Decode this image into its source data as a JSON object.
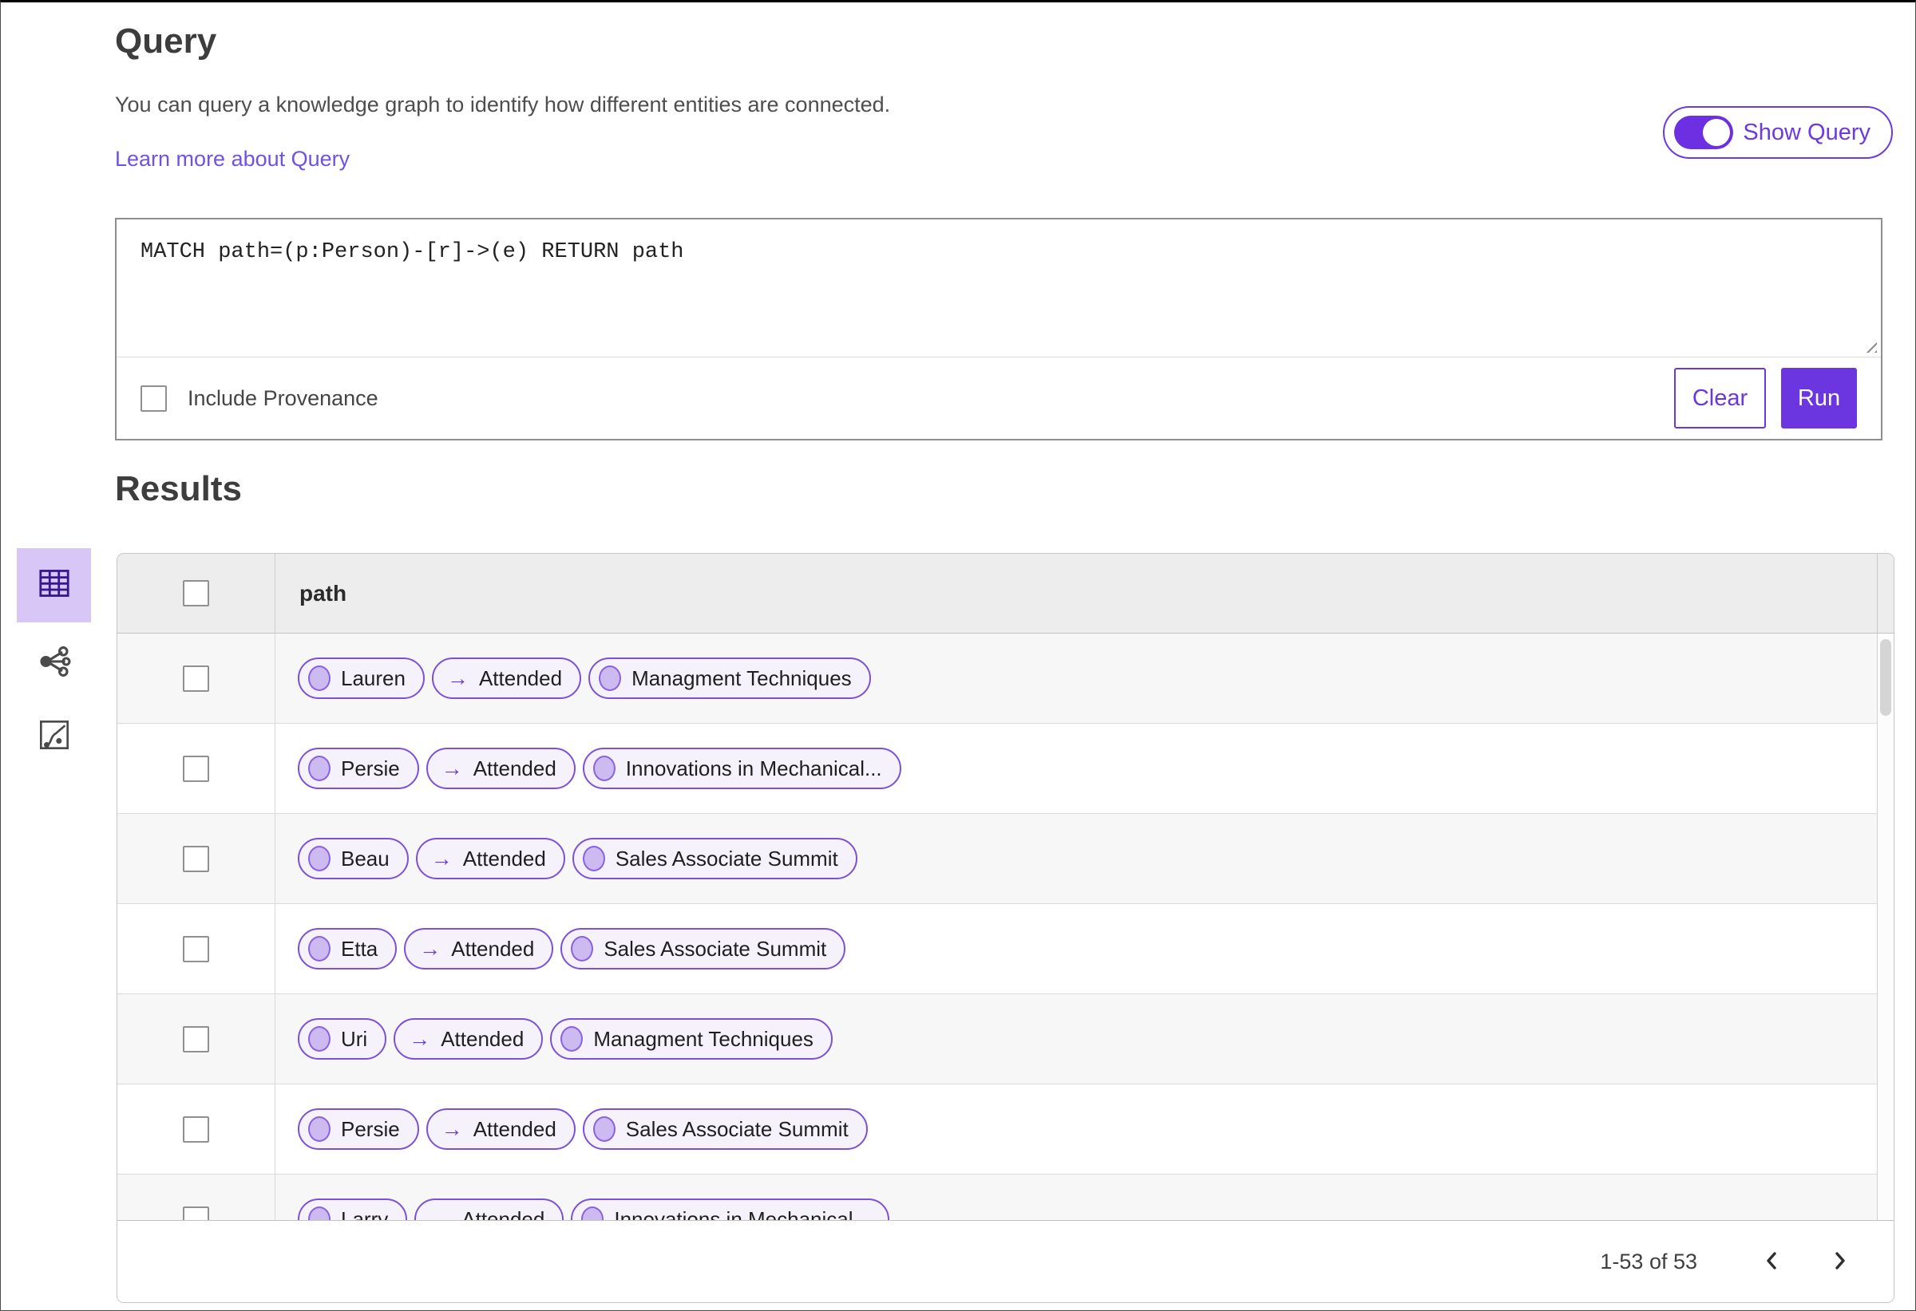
{
  "colors": {
    "accent_purple": "#6b35df",
    "pill_border": "#7b51d9",
    "pill_background": "#f5f2fc",
    "selected_view_background": "#d8c6f7"
  },
  "query": {
    "title": "Query",
    "description": "You can query a knowledge graph to identify how different entities are connected.",
    "learn_more_link": "Learn more about Query",
    "show_query_toggle_label": "Show Query",
    "show_query_toggle_on": true,
    "editor_text": "MATCH path=(p:Person)-[r]->(e) RETURN path",
    "include_provenance_label": "Include Provenance",
    "include_provenance_checked": false,
    "clear_button": "Clear",
    "run_button": "Run"
  },
  "results": {
    "title": "Results",
    "views": [
      {
        "name": "table-view",
        "selected": true
      },
      {
        "name": "graph-view",
        "selected": false
      },
      {
        "name": "chart-view",
        "selected": false
      }
    ],
    "table": {
      "column_header": "path",
      "edge_arrow": "→",
      "rows": [
        {
          "source": "Lauren",
          "edge": "Attended",
          "target": "Managment Techniques"
        },
        {
          "source": "Persie",
          "edge": "Attended",
          "target": "Innovations in Mechanical..."
        },
        {
          "source": "Beau",
          "edge": "Attended",
          "target": "Sales Associate Summit"
        },
        {
          "source": "Etta",
          "edge": "Attended",
          "target": "Sales Associate Summit"
        },
        {
          "source": "Uri",
          "edge": "Attended",
          "target": "Managment Techniques"
        },
        {
          "source": "Persie",
          "edge": "Attended",
          "target": "Sales Associate Summit"
        },
        {
          "source": "Larry",
          "edge": "Attended",
          "target": "Innovations in Mechanical..."
        }
      ]
    },
    "pagination": {
      "range_label": "1-53 of 53",
      "prev_icon": "chevron-left",
      "next_icon": "chevron-right"
    }
  }
}
